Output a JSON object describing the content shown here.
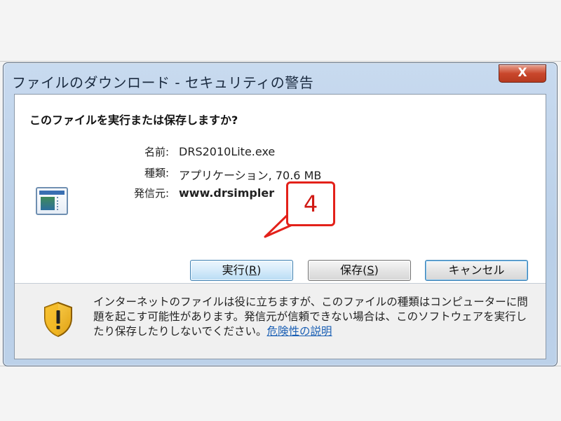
{
  "window": {
    "title": "ファイルのダウンロード - セキュリティの警告",
    "close_label": "X"
  },
  "dialog": {
    "question": "このファイルを実行または保存しますか?",
    "file": {
      "name_label": "名前:",
      "name_value": "DRS2010Lite.exe",
      "type_label": "種類:",
      "type_value": "アプリケーション, 70.6 MB",
      "from_label": "発信元:",
      "from_value": "www.drsimpler"
    },
    "buttons": {
      "run": "実行",
      "run_key": "R",
      "save": "保存",
      "save_key": "S",
      "cancel": "キャンセル"
    },
    "warning": {
      "text": "インターネットのファイルは役に立ちますが、このファイルの種類はコンピューターに問題を起こす可能性があります。発信元が信頼できない場合は、このソフトウェアを実行したり保存したりしないでください。",
      "link": "危険性の説明"
    }
  },
  "annotation": {
    "step_number": "4",
    "color": "#e3211a"
  },
  "icons": [
    "close-icon",
    "application-icon",
    "warning-shield-icon"
  ]
}
